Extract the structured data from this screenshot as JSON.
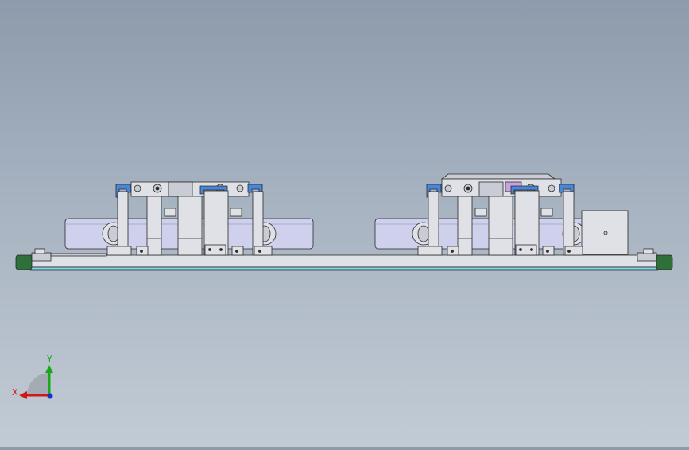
{
  "viewport": {
    "background_top": "#8d9bac",
    "background_bottom": "#c2cbd5"
  },
  "triad": {
    "x_label": "X",
    "y_label": "Y",
    "x_color": "#d01818",
    "y_color": "#18a818",
    "z_color": "#1830d0"
  },
  "colors": {
    "part_light": "#dfe1e6",
    "part_mid": "#c9ccd4",
    "outline": "#2a2a2a",
    "blue_accent": "#4a86d8",
    "cyan_edge": "#7fd6e8",
    "lavender": "#cfd1ec",
    "green_foot": "#2f6f3a"
  }
}
